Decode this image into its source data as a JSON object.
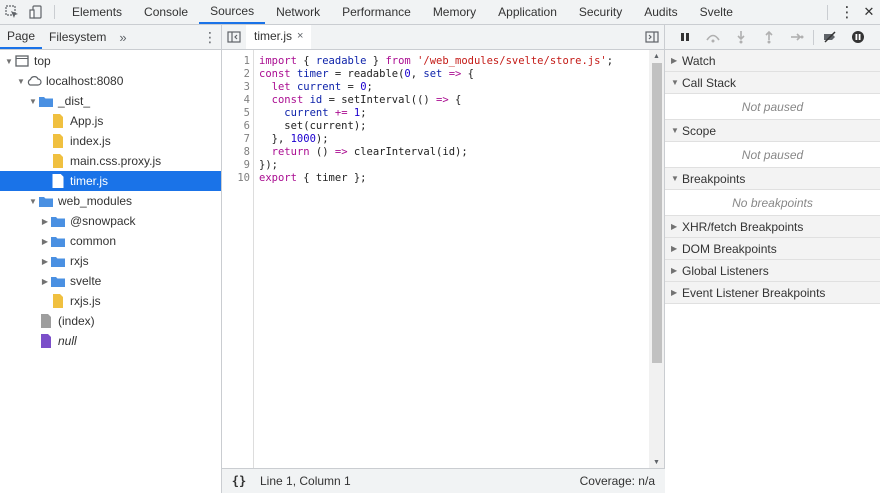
{
  "toolbar": {
    "inspect_icon": "inspect-element-icon",
    "device_icon": "device-toolbar-icon",
    "tabs": [
      "Elements",
      "Console",
      "Sources",
      "Network",
      "Performance",
      "Memory",
      "Application",
      "Security",
      "Audits",
      "Svelte"
    ],
    "active_tab": "Sources",
    "menu_icon": "⋮",
    "close_icon": "✕"
  },
  "navigator": {
    "tabs": [
      "Page",
      "Filesystem"
    ],
    "active_tab": "Page",
    "more_label": "»",
    "menu_icon": "⋮",
    "tree": [
      {
        "label": "top",
        "depth": 0,
        "arrow": "▼",
        "icon": "frame-icon"
      },
      {
        "label": "localhost:8080",
        "depth": 1,
        "arrow": "▼",
        "icon": "cloud-icon"
      },
      {
        "label": "_dist_",
        "depth": 2,
        "arrow": "▼",
        "icon": "folder-icon"
      },
      {
        "label": "App.js",
        "depth": 3,
        "arrow": "",
        "icon": "js-file-icon"
      },
      {
        "label": "index.js",
        "depth": 3,
        "arrow": "",
        "icon": "js-file-icon"
      },
      {
        "label": "main.css.proxy.js",
        "depth": 3,
        "arrow": "",
        "icon": "js-file-icon"
      },
      {
        "label": "timer.js",
        "depth": 3,
        "arrow": "",
        "icon": "file-icon",
        "selected": true
      },
      {
        "label": "web_modules",
        "depth": 2,
        "arrow": "▼",
        "icon": "folder-icon"
      },
      {
        "label": "@snowpack",
        "depth": 3,
        "arrow": "▶",
        "icon": "folder-icon"
      },
      {
        "label": "common",
        "depth": 3,
        "arrow": "▶",
        "icon": "folder-icon"
      },
      {
        "label": "rxjs",
        "depth": 3,
        "arrow": "▶",
        "icon": "folder-icon"
      },
      {
        "label": "svelte",
        "depth": 3,
        "arrow": "▶",
        "icon": "folder-icon"
      },
      {
        "label": "rxjs.js",
        "depth": 3,
        "arrow": "",
        "icon": "js-file-icon"
      },
      {
        "label": "(index)",
        "depth": 2,
        "arrow": "",
        "icon": "document-icon"
      },
      {
        "label": "null",
        "depth": 2,
        "arrow": "",
        "icon": "purple-document-icon",
        "italic": true
      }
    ]
  },
  "editor": {
    "tab_label": "timer.js",
    "tab_close": "×",
    "lines": [
      {
        "n": "1",
        "html": "<span class=\"kw\">import</span> { <span class=\"vname\">readable</span> } <span class=\"kw\">from</span> <span class=\"str\">'/web_modules/svelte/store.js'</span>;"
      },
      {
        "n": "2",
        "html": "<span class=\"kw\">const</span> <span class=\"vname\">timer</span> = readable(<span class=\"num\">0</span>, <span class=\"vname\">set</span> <span class=\"op\">=&gt;</span> {"
      },
      {
        "n": "3",
        "html": "  <span class=\"kw\">let</span> <span class=\"vname\">current</span> = <span class=\"num\">0</span>;"
      },
      {
        "n": "4",
        "html": "  <span class=\"kw\">const</span> <span class=\"vname\">id</span> = setInterval(() <span class=\"op\">=&gt;</span> {"
      },
      {
        "n": "5",
        "html": "    <span class=\"vname\">current</span> <span class=\"op\">+=</span> <span class=\"num\">1</span>;"
      },
      {
        "n": "6",
        "html": "    set(current);"
      },
      {
        "n": "7",
        "html": "  }, <span class=\"num\">1000</span>);"
      },
      {
        "n": "8",
        "html": "  <span class=\"kw\">return</span> () <span class=\"op\">=&gt;</span> clearInterval(id);"
      },
      {
        "n": "9",
        "html": "});"
      },
      {
        "n": "10",
        "html": "<span class=\"kw\">export</span> { timer };"
      }
    ],
    "format_label": "{}",
    "cursor_position": "Line 1, Column 1",
    "coverage": "Coverage: n/a"
  },
  "debugger": {
    "controls": [
      "pause-icon",
      "step-over-icon",
      "step-into-icon",
      "step-out-icon",
      "step-icon",
      "deactivate-breakpoints-icon",
      "pause-on-exceptions-icon"
    ],
    "sections": [
      {
        "title": "Watch",
        "expanded": false
      },
      {
        "title": "Call Stack",
        "expanded": true,
        "body": "Not paused"
      },
      {
        "title": "Scope",
        "expanded": true,
        "body": "Not paused"
      },
      {
        "title": "Breakpoints",
        "expanded": true,
        "body": "No breakpoints"
      },
      {
        "title": "XHR/fetch Breakpoints",
        "expanded": false
      },
      {
        "title": "DOM Breakpoints",
        "expanded": false
      },
      {
        "title": "Global Listeners",
        "expanded": false
      },
      {
        "title": "Event Listener Breakpoints",
        "expanded": false
      }
    ]
  },
  "colors": {
    "accent": "#1a73e8",
    "folder": "#4a90e2",
    "js_file": "#f0c040",
    "document": "#9e9e9e",
    "null_doc": "#7b4fc9"
  }
}
